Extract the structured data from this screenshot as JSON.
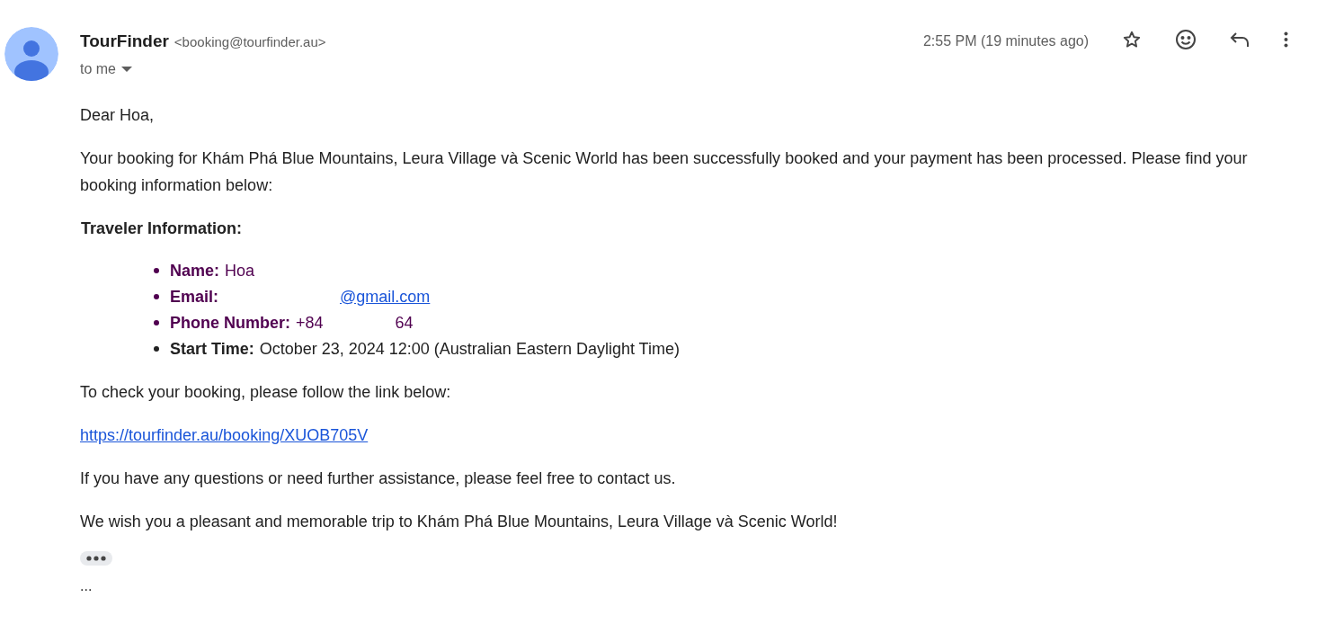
{
  "sender": {
    "name": "TourFinder",
    "address": "<booking@tourfinder.au>",
    "recipient": "to me"
  },
  "time": "2:55 PM (19 minutes ago)",
  "body": {
    "greeting": "Dear Hoa,",
    "intro": "Your booking for Khám Phá Blue Mountains, Leura Village và Scenic World has been successfully booked and your payment has been processed. Please find your booking information below:",
    "section_title": "Traveler Information:",
    "items": [
      {
        "label": "Name:",
        "value": "Hoa",
        "kind": "text",
        "color": "#500050"
      },
      {
        "label": "Email:",
        "value": "@gmail.com",
        "kind": "redacted_link",
        "color": "#500050"
      },
      {
        "label": "Phone Number:",
        "value": "+84",
        "value_end": "64",
        "kind": "redacted_text",
        "color": "#500050"
      },
      {
        "label": "Start Time:",
        "value": "October 23, 2024 12:00 (Australian Eastern Daylight Time)",
        "kind": "text",
        "color": "#222222"
      }
    ],
    "check_text": "To check your booking, please follow the link below:",
    "link": "https://tourfinder.au/booking/XUOB705V",
    "help": "If you have any questions or need further assistance, please feel free to contact us.",
    "closing": "We wish you a pleasant and memorable trip to Khám Phá Blue Mountains, Leura Village và Scenic World!",
    "trailing": "..."
  }
}
